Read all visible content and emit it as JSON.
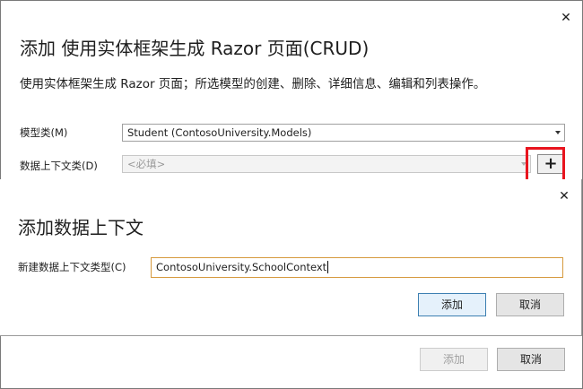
{
  "outer": {
    "close": "✕",
    "title": "添加 使用实体框架生成 Razor 页面(CRUD)",
    "description": "使用实体框架生成 Razor 页面；所选模型的创建、删除、详细信息、编辑和列表操作。",
    "model_label": "模型类(M)",
    "model_value": "Student (ContosoUniversity.Models)",
    "context_label": "数据上下文类(D)",
    "context_placeholder": "<必填>",
    "plus": "+",
    "add_button": "添加",
    "cancel_button": "取消"
  },
  "inner": {
    "close": "✕",
    "title": "添加数据上下文",
    "type_label": "新建数据上下文类型(C)",
    "type_value": "ContosoUniversity.SchoolContext",
    "add_button": "添加",
    "cancel_button": "取消"
  },
  "highlight_color": "#e8141e"
}
